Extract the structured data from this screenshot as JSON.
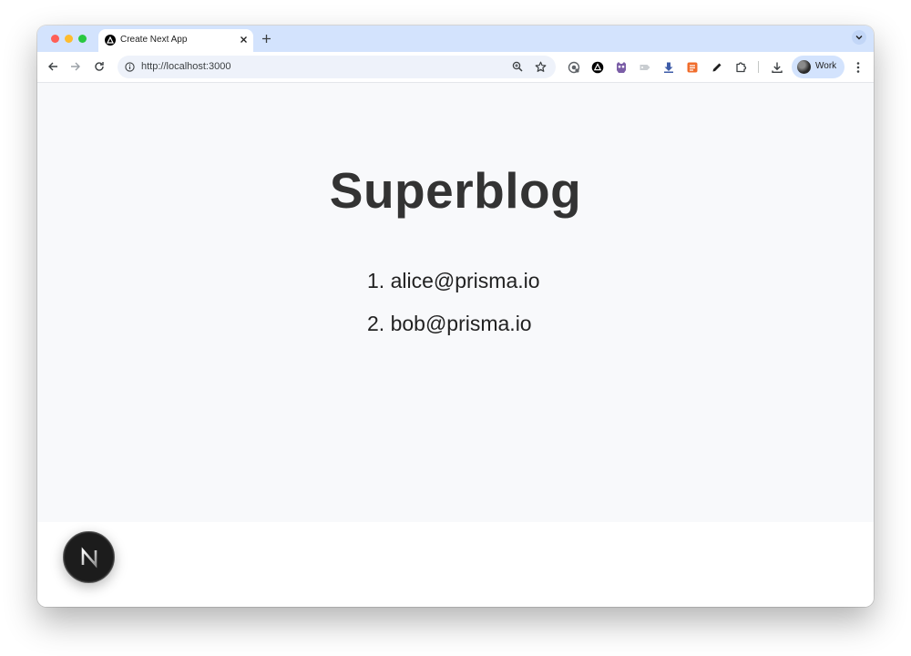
{
  "browser": {
    "tab": {
      "title": "Create Next App"
    },
    "address_bar": {
      "url": "http://localhost:3000"
    },
    "profile": {
      "label": "Work"
    }
  },
  "page": {
    "title": "Superblog",
    "users": [
      {
        "number": "1.",
        "email": "alice@prisma.io"
      },
      {
        "number": "2.",
        "email": "bob@prisma.io"
      }
    ]
  },
  "dev_badge": {
    "letter": "N"
  },
  "colors": {
    "tabstrip": "#d3e3fd",
    "page_background": "#f8f9fb",
    "title_text": "#333333"
  }
}
